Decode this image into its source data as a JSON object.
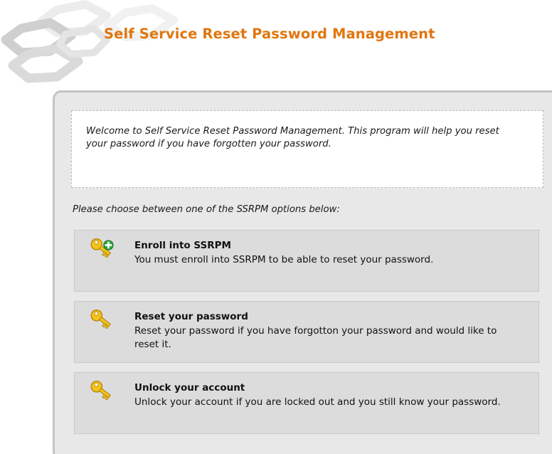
{
  "header": {
    "title": "Self Service Reset Password Management"
  },
  "welcome": {
    "text": "Welcome to Self Service Reset Password Management. This program will help you reset your password if you have forgotten your password."
  },
  "prompt": {
    "text": "Please choose between one of the SSRPM options below:"
  },
  "options": [
    {
      "icon": "key-add-icon",
      "title": "Enroll into SSRPM",
      "description": "You must enroll into SSRPM to be able to reset your password."
    },
    {
      "icon": "key-icon",
      "title": "Reset your password",
      "description": "Reset your password if you have forgotton your password and would like to reset it."
    },
    {
      "icon": "key-icon",
      "title": "Unlock your account",
      "description": "Unlock your account if you are locked out and you still know your password."
    }
  ],
  "colors": {
    "title": "#e0760f",
    "panel_bg": "#e8e8e8",
    "option_bg": "#dcdcdc",
    "key_gold": "#f2c41c"
  }
}
